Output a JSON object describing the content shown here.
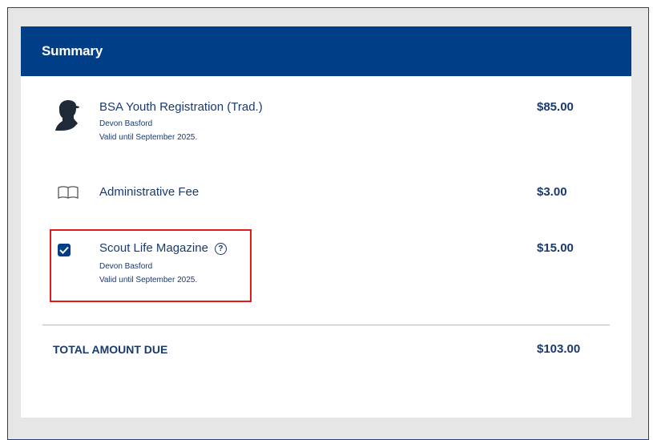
{
  "summary": {
    "title": "Summary",
    "items": [
      {
        "title": "BSA Youth Registration (Trad.)",
        "name": "Devon Basford",
        "validity": "Valid until September 2025.",
        "price": "$85.00",
        "icon": "scout-silhouette-icon"
      },
      {
        "title": "Administrative Fee",
        "price": "$3.00",
        "icon": "book-icon"
      },
      {
        "title": "Scout Life Magazine",
        "name": "Devon Basford",
        "validity": "Valid until September 2025.",
        "price": "$15.00",
        "checked": true,
        "help_icon": "question-circle-icon",
        "help_glyph": "?"
      }
    ],
    "total_label": "TOTAL AMOUNT DUE",
    "total_value": "$103.00"
  },
  "colors": {
    "header_bg": "#003f87",
    "text": "#1a3a6e",
    "highlight": "#e01b1b"
  }
}
